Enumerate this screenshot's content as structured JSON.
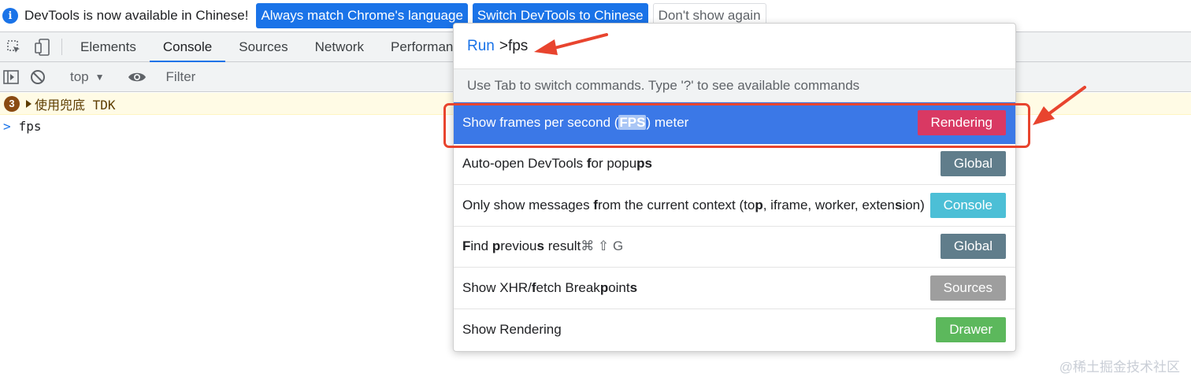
{
  "infobar": {
    "message": "DevTools is now available in Chinese!",
    "buttons": [
      "Always match Chrome's language",
      "Switch DevTools to Chinese",
      "Don't show again"
    ]
  },
  "tabs": [
    "Elements",
    "Console",
    "Sources",
    "Network",
    "Performan"
  ],
  "console_toolbar": {
    "context": "top",
    "filter_placeholder": "Filter"
  },
  "console": {
    "warning_count": "3",
    "warning_text": "使用兜底 TDK",
    "input_text": "fps"
  },
  "command_menu": {
    "prefix": "Run",
    "query": ">fps",
    "hint": "Use Tab to switch commands. Type '?' to see available commands",
    "items": [
      {
        "text": "Show frames per second (FPS) meter",
        "badge": "Rendering",
        "badge_color": "#d93963"
      },
      {
        "text": "Auto-open DevTools for popups",
        "badge": "Global",
        "badge_color": "#607d8b"
      },
      {
        "text": "Only show messages from the current context (top, iframe, worker, extension)",
        "badge": "Console",
        "badge_color": "#4cbfd6"
      },
      {
        "text": "Find previous result",
        "shortcut": "⌘ ⇧ G",
        "badge": "Global",
        "badge_color": "#607d8b"
      },
      {
        "text": "Show XHR/fetch Breakpoints",
        "badge": "Sources",
        "badge_color": "#9e9e9e"
      },
      {
        "text": "Show Rendering",
        "badge": "Drawer",
        "badge_color": "#5cb85c"
      }
    ]
  },
  "watermark": "@稀土掘金技术社区",
  "colors": {
    "accent": "#1a73e8",
    "selection": "#3b78e7",
    "annotation": "#e8442e"
  }
}
